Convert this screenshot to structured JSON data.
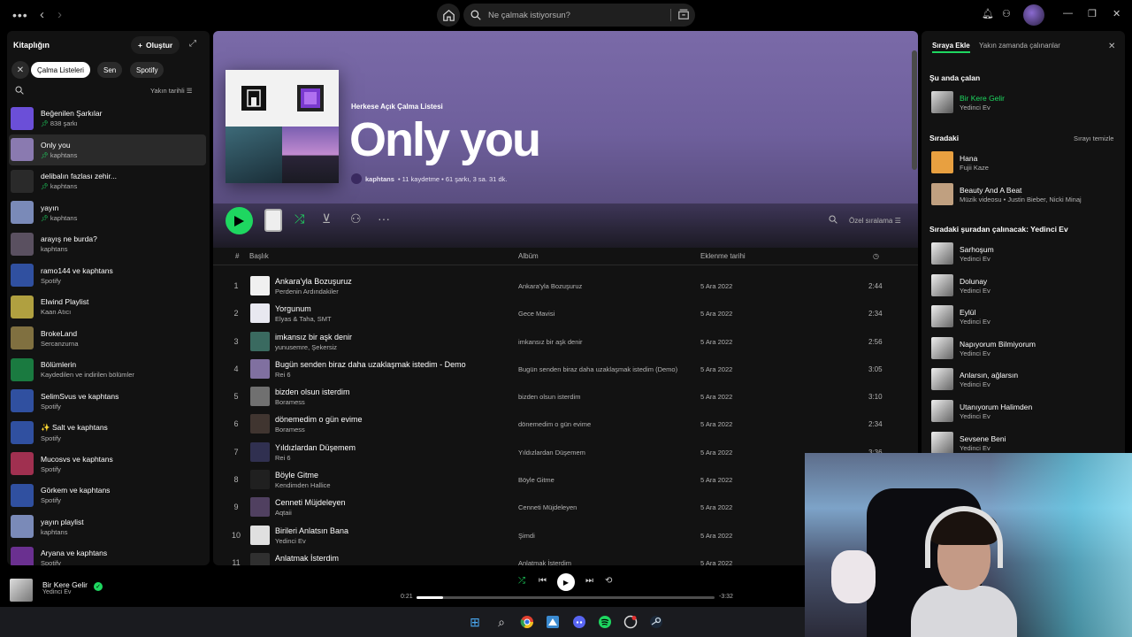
{
  "topbar": {
    "search_placeholder": "Ne çalmak istiyorsun?"
  },
  "library": {
    "title": "Kitaplığın",
    "create_label": "Oluştur",
    "chips": [
      "Çalma Listeleri",
      "Sen",
      "Spotify"
    ],
    "sort_label": "Yakın tarihli",
    "items": [
      {
        "name": "Beğenilen Şarkılar",
        "sub": "838 şarkı",
        "pinned": true,
        "color": "#6b4fd8"
      },
      {
        "name": "Only you",
        "sub": "kaphtans",
        "pinned": true,
        "color": "#8a7ab0"
      },
      {
        "name": "delibalın fazlası zehir...",
        "sub": "kaphtans",
        "pinned": true,
        "color": "#2a2a2a"
      },
      {
        "name": "yayın",
        "sub": "kaphtans",
        "pinned": true,
        "color": "#7a8ab8"
      },
      {
        "name": "arayış ne burda?",
        "sub": "kaphtans",
        "pinned": false,
        "color": "#5a5060"
      },
      {
        "name": "ramo144 ve kaphtans",
        "sub": "Spotify",
        "pinned": false,
        "color": "#3050a0"
      },
      {
        "name": "Elwind Playlist",
        "sub": "Kaan Atıcı",
        "pinned": false,
        "color": "#b0a040"
      },
      {
        "name": "BrokeLand",
        "sub": "Sercanzurna",
        "pinned": false,
        "color": "#807040"
      },
      {
        "name": "Bölümlerin",
        "sub": "Kaydedilen ve indirilen bölümler",
        "pinned": false,
        "color": "#1a7a40"
      },
      {
        "name": "SelimSvus ve kaphtans",
        "sub": "Spotify",
        "pinned": false,
        "color": "#3050a0"
      },
      {
        "name": "✨ Salt ve kaphtans",
        "sub": "Spotify",
        "pinned": false,
        "color": "#3050a0"
      },
      {
        "name": "Mucosvs ve kaphtans",
        "sub": "Spotify",
        "pinned": false,
        "color": "#a03050"
      },
      {
        "name": "Görkem ve kaphtans",
        "sub": "Spotify",
        "pinned": false,
        "color": "#3050a0"
      },
      {
        "name": "yayın playlist",
        "sub": "kaphtans",
        "pinned": false,
        "color": "#7a8ab8"
      },
      {
        "name": "Aryana ve kaphtans",
        "sub": "Spotify",
        "pinned": false,
        "color": "#6a3090"
      }
    ]
  },
  "playlist": {
    "type_label": "Herkese Açık Çalma Listesi",
    "title": "Only you",
    "owner": "kaphtans",
    "meta": "• 11 kaydetme • 61 şarkı, 3 sa. 31 dk.",
    "sort_label": "Özel sıralama",
    "columns": {
      "num": "#",
      "title": "Başlık",
      "album": "Albüm",
      "date": "Eklenme tarihi"
    },
    "tracks": [
      {
        "n": "1",
        "title": "Ankara'yla Bozuşuruz",
        "artist": "Perdenin Ardındakiler",
        "album": "Ankara'yla Bozuşuruz",
        "date": "5 Ara 2022",
        "dur": "2:44",
        "color": "#f0f0f0"
      },
      {
        "n": "2",
        "title": "Yorgunum",
        "artist": "Elyas & Taha, SMT",
        "album": "Gece Mavisi",
        "date": "5 Ara 2022",
        "dur": "2:34",
        "color": "#e8e8f0"
      },
      {
        "n": "3",
        "title": "imkansız bir aşk denir",
        "artist": "yunusemre, Şekersiz",
        "album": "imkansız bir aşk denir",
        "date": "5 Ara 2022",
        "dur": "2:56",
        "color": "#3a6a60"
      },
      {
        "n": "4",
        "title": "Bugün senden biraz daha uzaklaşmak istedim - Demo",
        "artist": "Rei 6",
        "album": "Bugün senden biraz daha uzaklaşmak istedim (Demo)",
        "date": "5 Ara 2022",
        "dur": "3:05",
        "color": "#8070a0"
      },
      {
        "n": "5",
        "title": "bizden olsun isterdim",
        "artist": "Boramess",
        "album": "bizden olsun isterdim",
        "date": "5 Ara 2022",
        "dur": "3:10",
        "color": "#707070"
      },
      {
        "n": "6",
        "title": "dönemedim o gün evime",
        "artist": "Boramess",
        "album": "dönemedim o gün evime",
        "date": "5 Ara 2022",
        "dur": "2:34",
        "color": "#403530"
      },
      {
        "n": "7",
        "title": "Yıldızlardan Düşemem",
        "artist": "Rei 6",
        "album": "Yıldızlardan Düşemem",
        "date": "5 Ara 2022",
        "dur": "3:36",
        "color": "#303050"
      },
      {
        "n": "8",
        "title": "Böyle Gitme",
        "artist": "Kendimden Hallice",
        "album": "Böyle Gitme",
        "date": "5 Ara 2022",
        "dur": "",
        "color": "#202020"
      },
      {
        "n": "9",
        "title": "Cenneti Müjdeleyen",
        "artist": "Aqtaii",
        "album": "Cenneti Müjdeleyen",
        "date": "5 Ara 2022",
        "dur": "",
        "color": "#504060"
      },
      {
        "n": "10",
        "title": "Birileri Anlatsın Bana",
        "artist": "Yedinci Ev",
        "album": "Şimdi",
        "date": "5 Ara 2022",
        "dur": "",
        "color": "#e0e0e0"
      },
      {
        "n": "11",
        "title": "Anlatmak İsterdim",
        "artist": "",
        "album": "Anlatmak İsterdim",
        "date": "5 Ara 2022",
        "dur": "",
        "color": "#303030"
      }
    ]
  },
  "queue": {
    "tab_queue": "Sıraya Ekle",
    "tab_recent": "Yakın zamanda çalınanlar",
    "now_playing_label": "Şu anda çalan",
    "now_playing": {
      "title": "Bir Kere Gelir",
      "artist": "Yedinci Ev"
    },
    "next_label": "Sıradaki",
    "clear_label": "Sırayı temizle",
    "next": [
      {
        "title": "Hana",
        "artist": "Fujii Kaze",
        "color": "#e8a040"
      },
      {
        "title": "Beauty And A Beat",
        "artist": "Müzik videosu • Justin Bieber, Nicki Minaj",
        "color": "#c0a080"
      }
    ],
    "from_label": "Sıradaki şuradan çalınacak: Yedinci Ev",
    "from": [
      {
        "title": "Sarhoşum",
        "artist": "Yedinci Ev"
      },
      {
        "title": "Dolunay",
        "artist": "Yedinci Ev"
      },
      {
        "title": "Eylül",
        "artist": "Yedinci Ev"
      },
      {
        "title": "Napıyorum Bilmiyorum",
        "artist": "Yedinci Ev"
      },
      {
        "title": "Anlarsın, ağlarsın",
        "artist": "Yedinci Ev"
      },
      {
        "title": "Utanıyorum Halimden",
        "artist": "Yedinci Ev"
      },
      {
        "title": "Sevsene Beni",
        "artist": "Yedinci Ev"
      }
    ]
  },
  "player": {
    "title": "Bir Kere Gelir",
    "artist": "Yedinci Ev",
    "elapsed": "0:21",
    "remaining": "-3:32",
    "progress_fraction": 0.09
  },
  "colors": {
    "accent": "#1ed760",
    "hero": "#7a6aa8"
  }
}
